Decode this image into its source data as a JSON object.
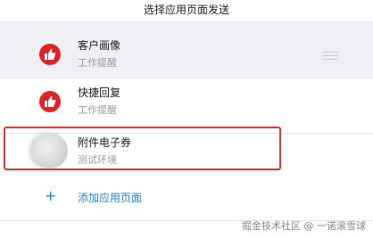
{
  "dialog": {
    "title": "选择应用页面发送"
  },
  "pages": [
    {
      "title": "客户画像",
      "subtitle": "工作提醒",
      "icon": "thumbs-up-icon",
      "selected": true
    },
    {
      "title": "快捷回复",
      "subtitle": "工作提醒",
      "icon": "thumbs-up-icon",
      "selected": false
    },
    {
      "title": "附件电子券",
      "subtitle": "测试环境",
      "icon": "blurred-avatar",
      "selected": false
    }
  ],
  "add_page": {
    "icon": "+",
    "label": "添加应用页面"
  },
  "colors": {
    "brand_red": "#e02424",
    "link_blue": "#1e88e5",
    "highlight_red": "#e53935"
  },
  "watermark": "掘金技术社区 @ 一诺滚雪球"
}
